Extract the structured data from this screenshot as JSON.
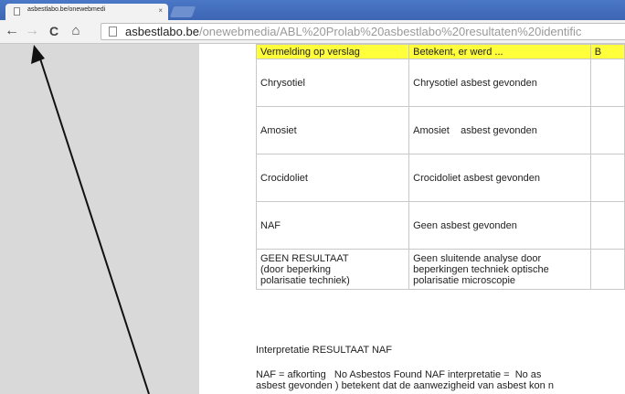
{
  "browser": {
    "tab": {
      "title": "asbestlabo.be/onewebmedi",
      "close_glyph": "×"
    },
    "nav": {
      "back_glyph": "←",
      "forward_glyph": "→",
      "reload_glyph": "C",
      "home_glyph": "⌂"
    },
    "address": {
      "host": "asbestlabo.be",
      "path": "/onewebmedia/ABL%20Prolab%20asbestlabo%20resultaten%20identific"
    }
  },
  "document": {
    "table": {
      "headers": [
        "Vermelding op verslag",
        "Betekent, er werd ...",
        "B"
      ],
      "rows": [
        {
          "term": "Chrysotiel",
          "meaning": "Chrysotiel  asbest gevonden"
        },
        {
          "term": "Amosiet",
          "meaning": "Amosiet    asbest gevonden"
        },
        {
          "term": "Crocidoliet",
          "meaning": "Crocidoliet asbest gevonden"
        },
        {
          "term": "NAF",
          "meaning": "Geen asbest gevonden"
        },
        {
          "term": "GEEN RESULTAAT\n(door beperking\npolarisatie techniek)",
          "meaning": "Geen sluitende analyse door\nbeperkingen techniek optische\npolarisatie microscopie"
        }
      ]
    },
    "interpretation": {
      "title": "Interpretatie RESULTAAT NAF",
      "line1": "NAF = afkorting   No Asbestos Found NAF interpretatie =  No as",
      "line2": "asbest gevonden ) betekent dat de aanwezigheid van asbest kon n"
    }
  },
  "colors": {
    "header_highlight": "#ffff3c",
    "tabstrip": "#4a77c6",
    "arrow": "#111111"
  }
}
